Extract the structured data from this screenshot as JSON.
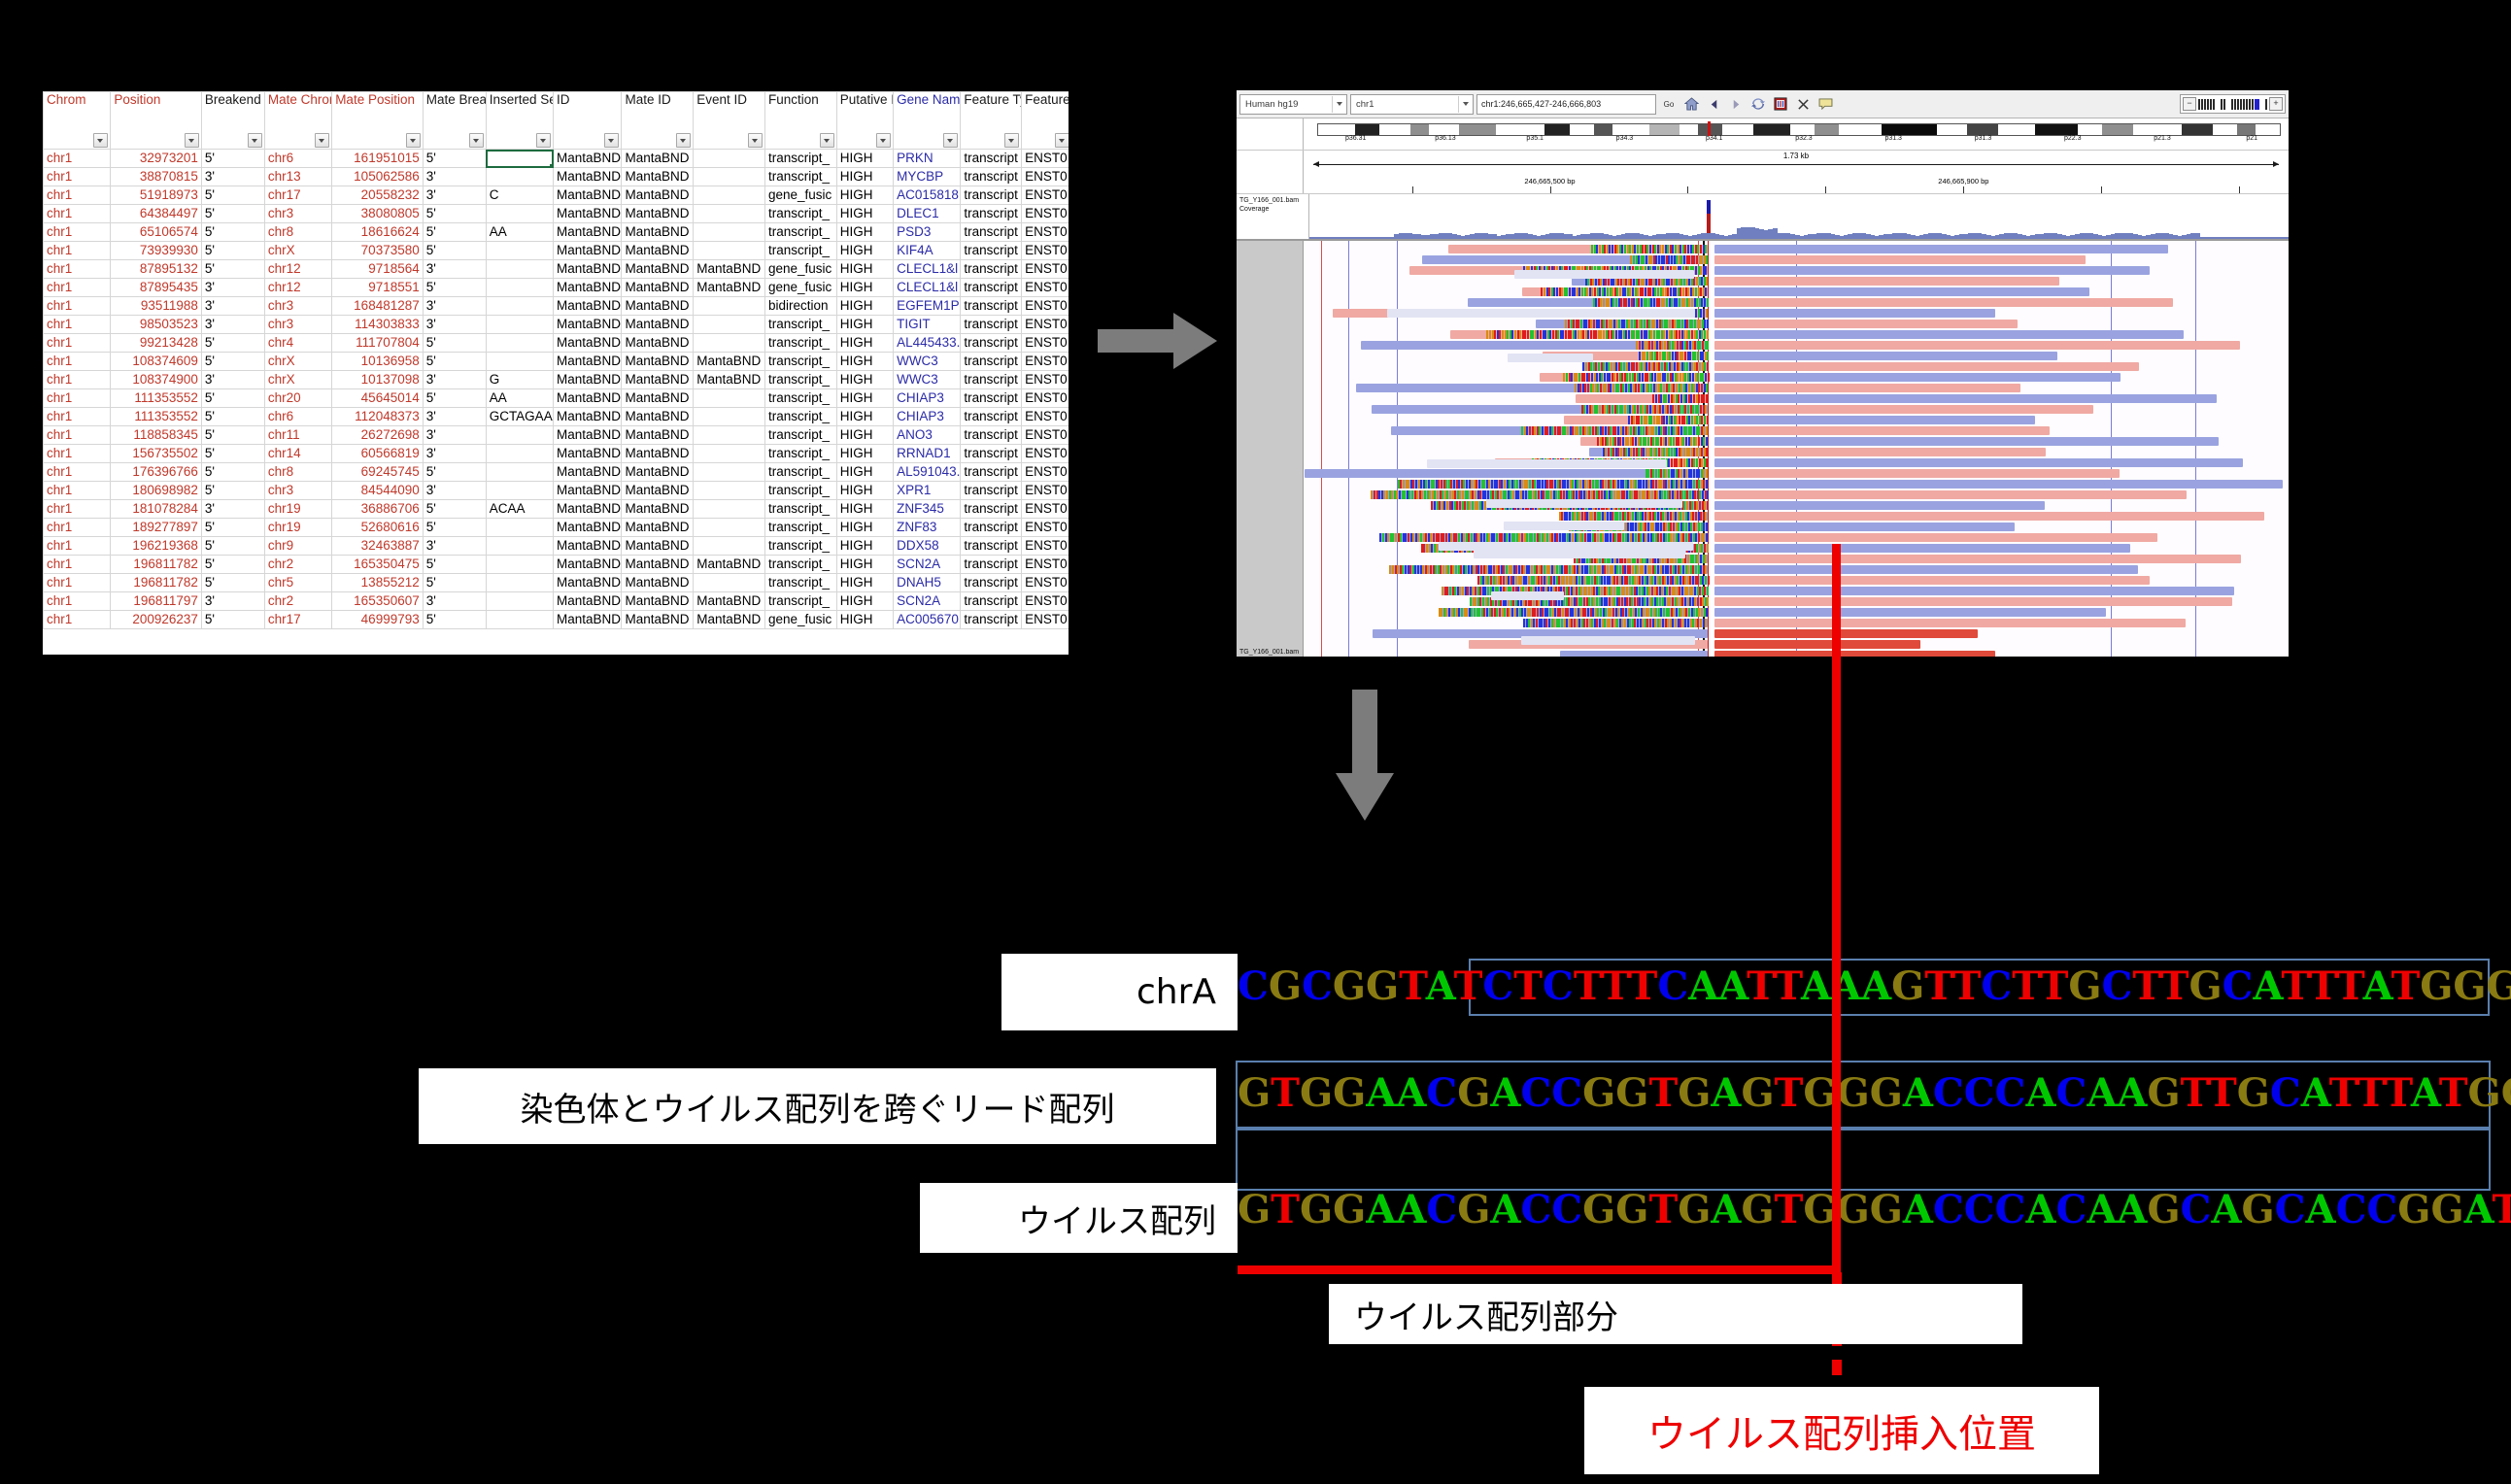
{
  "spreadsheet": {
    "columns": [
      {
        "label": "Chrom",
        "color": "red"
      },
      {
        "label": "Position",
        "color": "red"
      },
      {
        "label": "Breakend",
        "color": "black"
      },
      {
        "label": "Mate Chrom",
        "color": "red"
      },
      {
        "label": "Mate Position",
        "color": "red"
      },
      {
        "label": "Mate Breakend",
        "color": "black"
      },
      {
        "label": "Inserted Sequence",
        "color": "black"
      },
      {
        "label": "ID",
        "color": "black"
      },
      {
        "label": "Mate ID",
        "color": "black"
      },
      {
        "label": "Event ID",
        "color": "black"
      },
      {
        "label": "Function",
        "color": "black"
      },
      {
        "label": "Putative Impact",
        "color": "black"
      },
      {
        "label": "Gene Name",
        "color": "blue"
      },
      {
        "label": "Feature Type",
        "color": "black"
      },
      {
        "label": "Feature ID",
        "color": "black"
      }
    ],
    "rows": [
      [
        "chr1",
        "32973201",
        "5'",
        "chr6",
        "161951015",
        "5'",
        "",
        "MantaBND",
        "MantaBND",
        "",
        "transcript_",
        "HIGH",
        "PRKN",
        "transcript",
        "ENST0"
      ],
      [
        "chr1",
        "38870815",
        "3'",
        "chr13",
        "105062586",
        "3'",
        "",
        "MantaBND",
        "MantaBND",
        "",
        "transcript_",
        "HIGH",
        "MYCBP",
        "transcript",
        "ENST0"
      ],
      [
        "chr1",
        "51918973",
        "5'",
        "chr17",
        "20558232",
        "3'",
        "C",
        "MantaBND",
        "MantaBND",
        "",
        "gene_fusic",
        "HIGH",
        "AC015818",
        "transcript",
        "ENST0"
      ],
      [
        "chr1",
        "64384497",
        "5'",
        "chr3",
        "38080805",
        "5'",
        "",
        "MantaBND",
        "MantaBND",
        "",
        "transcript_",
        "HIGH",
        "DLEC1",
        "transcript",
        "ENST0"
      ],
      [
        "chr1",
        "65106574",
        "5'",
        "chr8",
        "18616624",
        "5'",
        "AA",
        "MantaBND",
        "MantaBND",
        "",
        "transcript_",
        "HIGH",
        "PSD3",
        "transcript",
        "ENST0"
      ],
      [
        "chr1",
        "73939930",
        "5'",
        "chrX",
        "70373580",
        "5'",
        "",
        "MantaBND",
        "MantaBND",
        "",
        "transcript_",
        "HIGH",
        "KIF4A",
        "transcript",
        "ENST0"
      ],
      [
        "chr1",
        "87895132",
        "5'",
        "chr12",
        "9718564",
        "3'",
        "",
        "MantaBND",
        "MantaBND",
        "MantaBND",
        "gene_fusic",
        "HIGH",
        "CLECL1&l",
        "transcript",
        "ENST0"
      ],
      [
        "chr1",
        "87895435",
        "3'",
        "chr12",
        "9718551",
        "5'",
        "",
        "MantaBND",
        "MantaBND",
        "MantaBND",
        "gene_fusic",
        "HIGH",
        "CLECL1&l",
        "transcript",
        "ENST0"
      ],
      [
        "chr1",
        "93511988",
        "3'",
        "chr3",
        "168481287",
        "3'",
        "",
        "MantaBND",
        "MantaBND",
        "",
        "bidirection",
        "HIGH",
        "EGFEM1P",
        "transcript",
        "ENST0"
      ],
      [
        "chr1",
        "98503523",
        "3'",
        "chr3",
        "114303833",
        "3'",
        "",
        "MantaBND",
        "MantaBND",
        "",
        "transcript_",
        "HIGH",
        "TIGIT",
        "transcript",
        "ENST0"
      ],
      [
        "chr1",
        "99213428",
        "5'",
        "chr4",
        "111707804",
        "5'",
        "",
        "MantaBND",
        "MantaBND",
        "",
        "transcript_",
        "HIGH",
        "AL445433.",
        "transcript",
        "ENST0"
      ],
      [
        "chr1",
        "108374609",
        "5'",
        "chrX",
        "10136958",
        "5'",
        "",
        "MantaBND",
        "MantaBND",
        "MantaBND",
        "transcript_",
        "HIGH",
        "WWC3",
        "transcript",
        "ENST0"
      ],
      [
        "chr1",
        "108374900",
        "3'",
        "chrX",
        "10137098",
        "3'",
        "G",
        "MantaBND",
        "MantaBND",
        "MantaBND",
        "transcript_",
        "HIGH",
        "WWC3",
        "transcript",
        "ENST0"
      ],
      [
        "chr1",
        "111353552",
        "5'",
        "chr20",
        "45645014",
        "5'",
        "AA",
        "MantaBND",
        "MantaBND",
        "",
        "transcript_",
        "HIGH",
        "CHIAP3",
        "transcript",
        "ENST0"
      ],
      [
        "chr1",
        "111353552",
        "5'",
        "chr6",
        "112048373",
        "3'",
        "GCTAGAA",
        "MantaBND",
        "MantaBND",
        "",
        "transcript_",
        "HIGH",
        "CHIAP3",
        "transcript",
        "ENST0"
      ],
      [
        "chr1",
        "118858345",
        "5'",
        "chr11",
        "26272698",
        "3'",
        "",
        "MantaBND",
        "MantaBND",
        "",
        "transcript_",
        "HIGH",
        "ANO3",
        "transcript",
        "ENST0"
      ],
      [
        "chr1",
        "156735502",
        "5'",
        "chr14",
        "60566819",
        "3'",
        "",
        "MantaBND",
        "MantaBND",
        "",
        "transcript_",
        "HIGH",
        "RRNAD1",
        "transcript",
        "ENST0"
      ],
      [
        "chr1",
        "176396766",
        "5'",
        "chr8",
        "69245745",
        "5'",
        "",
        "MantaBND",
        "MantaBND",
        "",
        "transcript_",
        "HIGH",
        "AL591043.",
        "transcript",
        "ENST0"
      ],
      [
        "chr1",
        "180698982",
        "5'",
        "chr3",
        "84544090",
        "3'",
        "",
        "MantaBND",
        "MantaBND",
        "",
        "transcript_",
        "HIGH",
        "XPR1",
        "transcript",
        "ENST0"
      ],
      [
        "chr1",
        "181078284",
        "3'",
        "chr19",
        "36886706",
        "5'",
        "ACAA",
        "MantaBND",
        "MantaBND",
        "",
        "transcript_",
        "HIGH",
        "ZNF345",
        "transcript",
        "ENST0"
      ],
      [
        "chr1",
        "189277897",
        "5'",
        "chr19",
        "52680616",
        "5'",
        "",
        "MantaBND",
        "MantaBND",
        "",
        "transcript_",
        "HIGH",
        "ZNF83",
        "transcript",
        "ENST0"
      ],
      [
        "chr1",
        "196219368",
        "5'",
        "chr9",
        "32463887",
        "3'",
        "",
        "MantaBND",
        "MantaBND",
        "",
        "transcript_",
        "HIGH",
        "DDX58",
        "transcript",
        "ENST0"
      ],
      [
        "chr1",
        "196811782",
        "5'",
        "chr2",
        "165350475",
        "5'",
        "",
        "MantaBND",
        "MantaBND",
        "MantaBND",
        "transcript_",
        "HIGH",
        "SCN2A",
        "transcript",
        "ENST0"
      ],
      [
        "chr1",
        "196811782",
        "5'",
        "chr5",
        "13855212",
        "5'",
        "",
        "MantaBND",
        "MantaBND",
        "",
        "transcript_",
        "HIGH",
        "DNAH5",
        "transcript",
        "ENST0"
      ],
      [
        "chr1",
        "196811797",
        "3'",
        "chr2",
        "165350607",
        "3'",
        "",
        "MantaBND",
        "MantaBND",
        "MantaBND",
        "transcript_",
        "HIGH",
        "SCN2A",
        "transcript",
        "ENST0"
      ],
      [
        "chr1",
        "200926237",
        "5'",
        "chr17",
        "46999793",
        "5'",
        "",
        "MantaBND",
        "MantaBND",
        "MantaBND",
        "gene_fusic",
        "HIGH",
        "AC005670",
        "transcript",
        "ENST0"
      ]
    ]
  },
  "igv": {
    "genome": "Human hg19",
    "chromosome": "chr1",
    "locus": "chr1:246,665,427-246,666,803",
    "zoom_label": "Go",
    "span_label": "1.73 kb",
    "ruler_ticks": [
      "246,665,500 bp",
      "246,665,900 bp"
    ],
    "coverage_track_label": "TG_Y166_001.bam Coverage",
    "alignment_track_label": "TG_Y166_001.bam",
    "cytobands": [
      "p36.31",
      "p36.13",
      "p35.1",
      "p34.3",
      "p34.1",
      "p32.3",
      "p31.3",
      "p31.3",
      "p22.3",
      "p21.3",
      "p21"
    ],
    "toolbar_icons": [
      "home-icon",
      "back-arrow-icon",
      "forward-arrow-icon",
      "refresh-icon",
      "region-tool-icon",
      "crosshair-icon",
      "popup-icon"
    ]
  },
  "sequences": {
    "row1": {
      "name": "chrA",
      "label": "chrA",
      "left": "CGCGGTATCTCTTTCAATTAAAGTTCTTGC",
      "right": "TTGCATTTATGGGAAACAGACCTGGTTCATGAA"
    },
    "row2": {
      "name": "read-spanning-chromosome-and-virus",
      "label": "染色体とウイルス配列を跨ぐリード配列",
      "left": "GTGGAACGACCGGTGAGTGGGACCCACAAG",
      "right": "TTGCATTTATGGGAAACAGACCTGGTTCATGAA"
    },
    "row3": {
      "name": "virus-sequence",
      "label": "ウイルス配列",
      "left": "GTGGAACGACCGGTGAGTGGGACCCACAAG",
      "right": "CAGCACCGGATCGTCACCCAATCGGGCTCAGCC"
    }
  },
  "annotations": {
    "virus_portion_label": "ウイルス配列部分",
    "insertion_point_label": "ウイルス配列挿入位置",
    "insertion_point_color": "#ee0000"
  },
  "base_colors": {
    "A": "#00c800",
    "C": "#0000ee",
    "G": "#8a7a12",
    "T": "#ee0000"
  }
}
